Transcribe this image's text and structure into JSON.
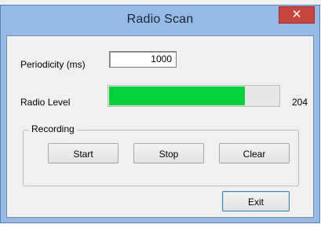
{
  "window": {
    "title": "Radio Scan",
    "close_glyph": "✕"
  },
  "fields": {
    "periodicity_label": "Periodicity (ms)",
    "periodicity_value": "1000",
    "radio_level_label": "Radio Level",
    "radio_level_value": "204",
    "radio_level_fill_fraction": 0.8
  },
  "recording": {
    "group_label": "Recording",
    "start_label": "Start",
    "stop_label": "Stop",
    "clear_label": "Clear"
  },
  "footer": {
    "exit_label": "Exit"
  },
  "colors": {
    "meter_fill": "#06d13a",
    "title_bar": "#97b9e6",
    "close_button": "#c74740"
  }
}
